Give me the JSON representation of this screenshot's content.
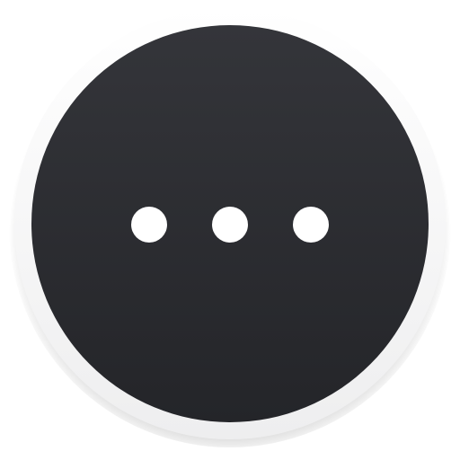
{
  "icon": {
    "name": "more-options-icon",
    "glyph": "ellipsis",
    "dot_count": 3,
    "colors": {
      "background": "#ffffff",
      "outer_ring": "#f7f7f8",
      "disc_top": "#34353a",
      "disc_bottom": "#242529",
      "dots": "#ffffff"
    }
  }
}
